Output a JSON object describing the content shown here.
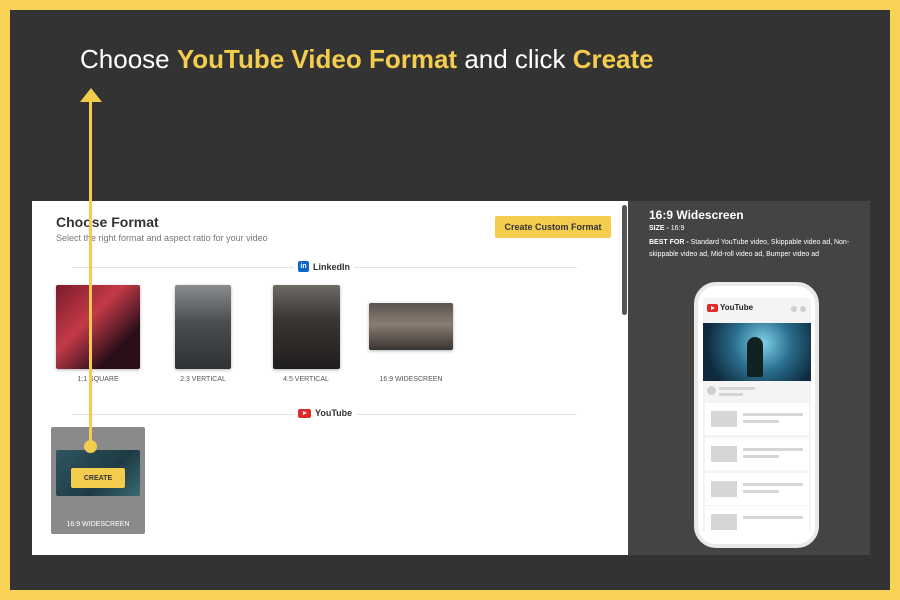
{
  "headline": {
    "part1": "Choose ",
    "highlight1": "YouTube Video Format",
    "part2": " and click ",
    "highlight2": "Create"
  },
  "panel": {
    "title": "Choose Format",
    "subtitle": "Select the right format and aspect ratio for your video",
    "custom_button": "Create Custom Format",
    "linkedin_label": "LinkedIn",
    "youtube_label": "YouTube",
    "linkedin_formats": [
      {
        "label": "1:1 SQUARE"
      },
      {
        "label": "2:3 VERTICAL"
      },
      {
        "label": "4:5 VERTICAL"
      },
      {
        "label": "16:9 WIDESCREEN"
      }
    ],
    "youtube_formats": [
      {
        "label": "16:9 WIDESCREEN",
        "button": "CREATE"
      }
    ]
  },
  "preview": {
    "title": "16:9 Widescreen",
    "size_label": "SIZE - ",
    "size_value": "16:9",
    "best_for_label": "BEST FOR - ",
    "best_for_value": "Standard YouTube video, Skippable video ad, Non-skippable video ad, Mid-roll video ad, Bumper video ad",
    "phone_brand": "YouTube"
  },
  "colors": {
    "accent": "#f4cd4e",
    "background": "#333333",
    "border": "#f7d257",
    "preview_bg": "#444444"
  }
}
